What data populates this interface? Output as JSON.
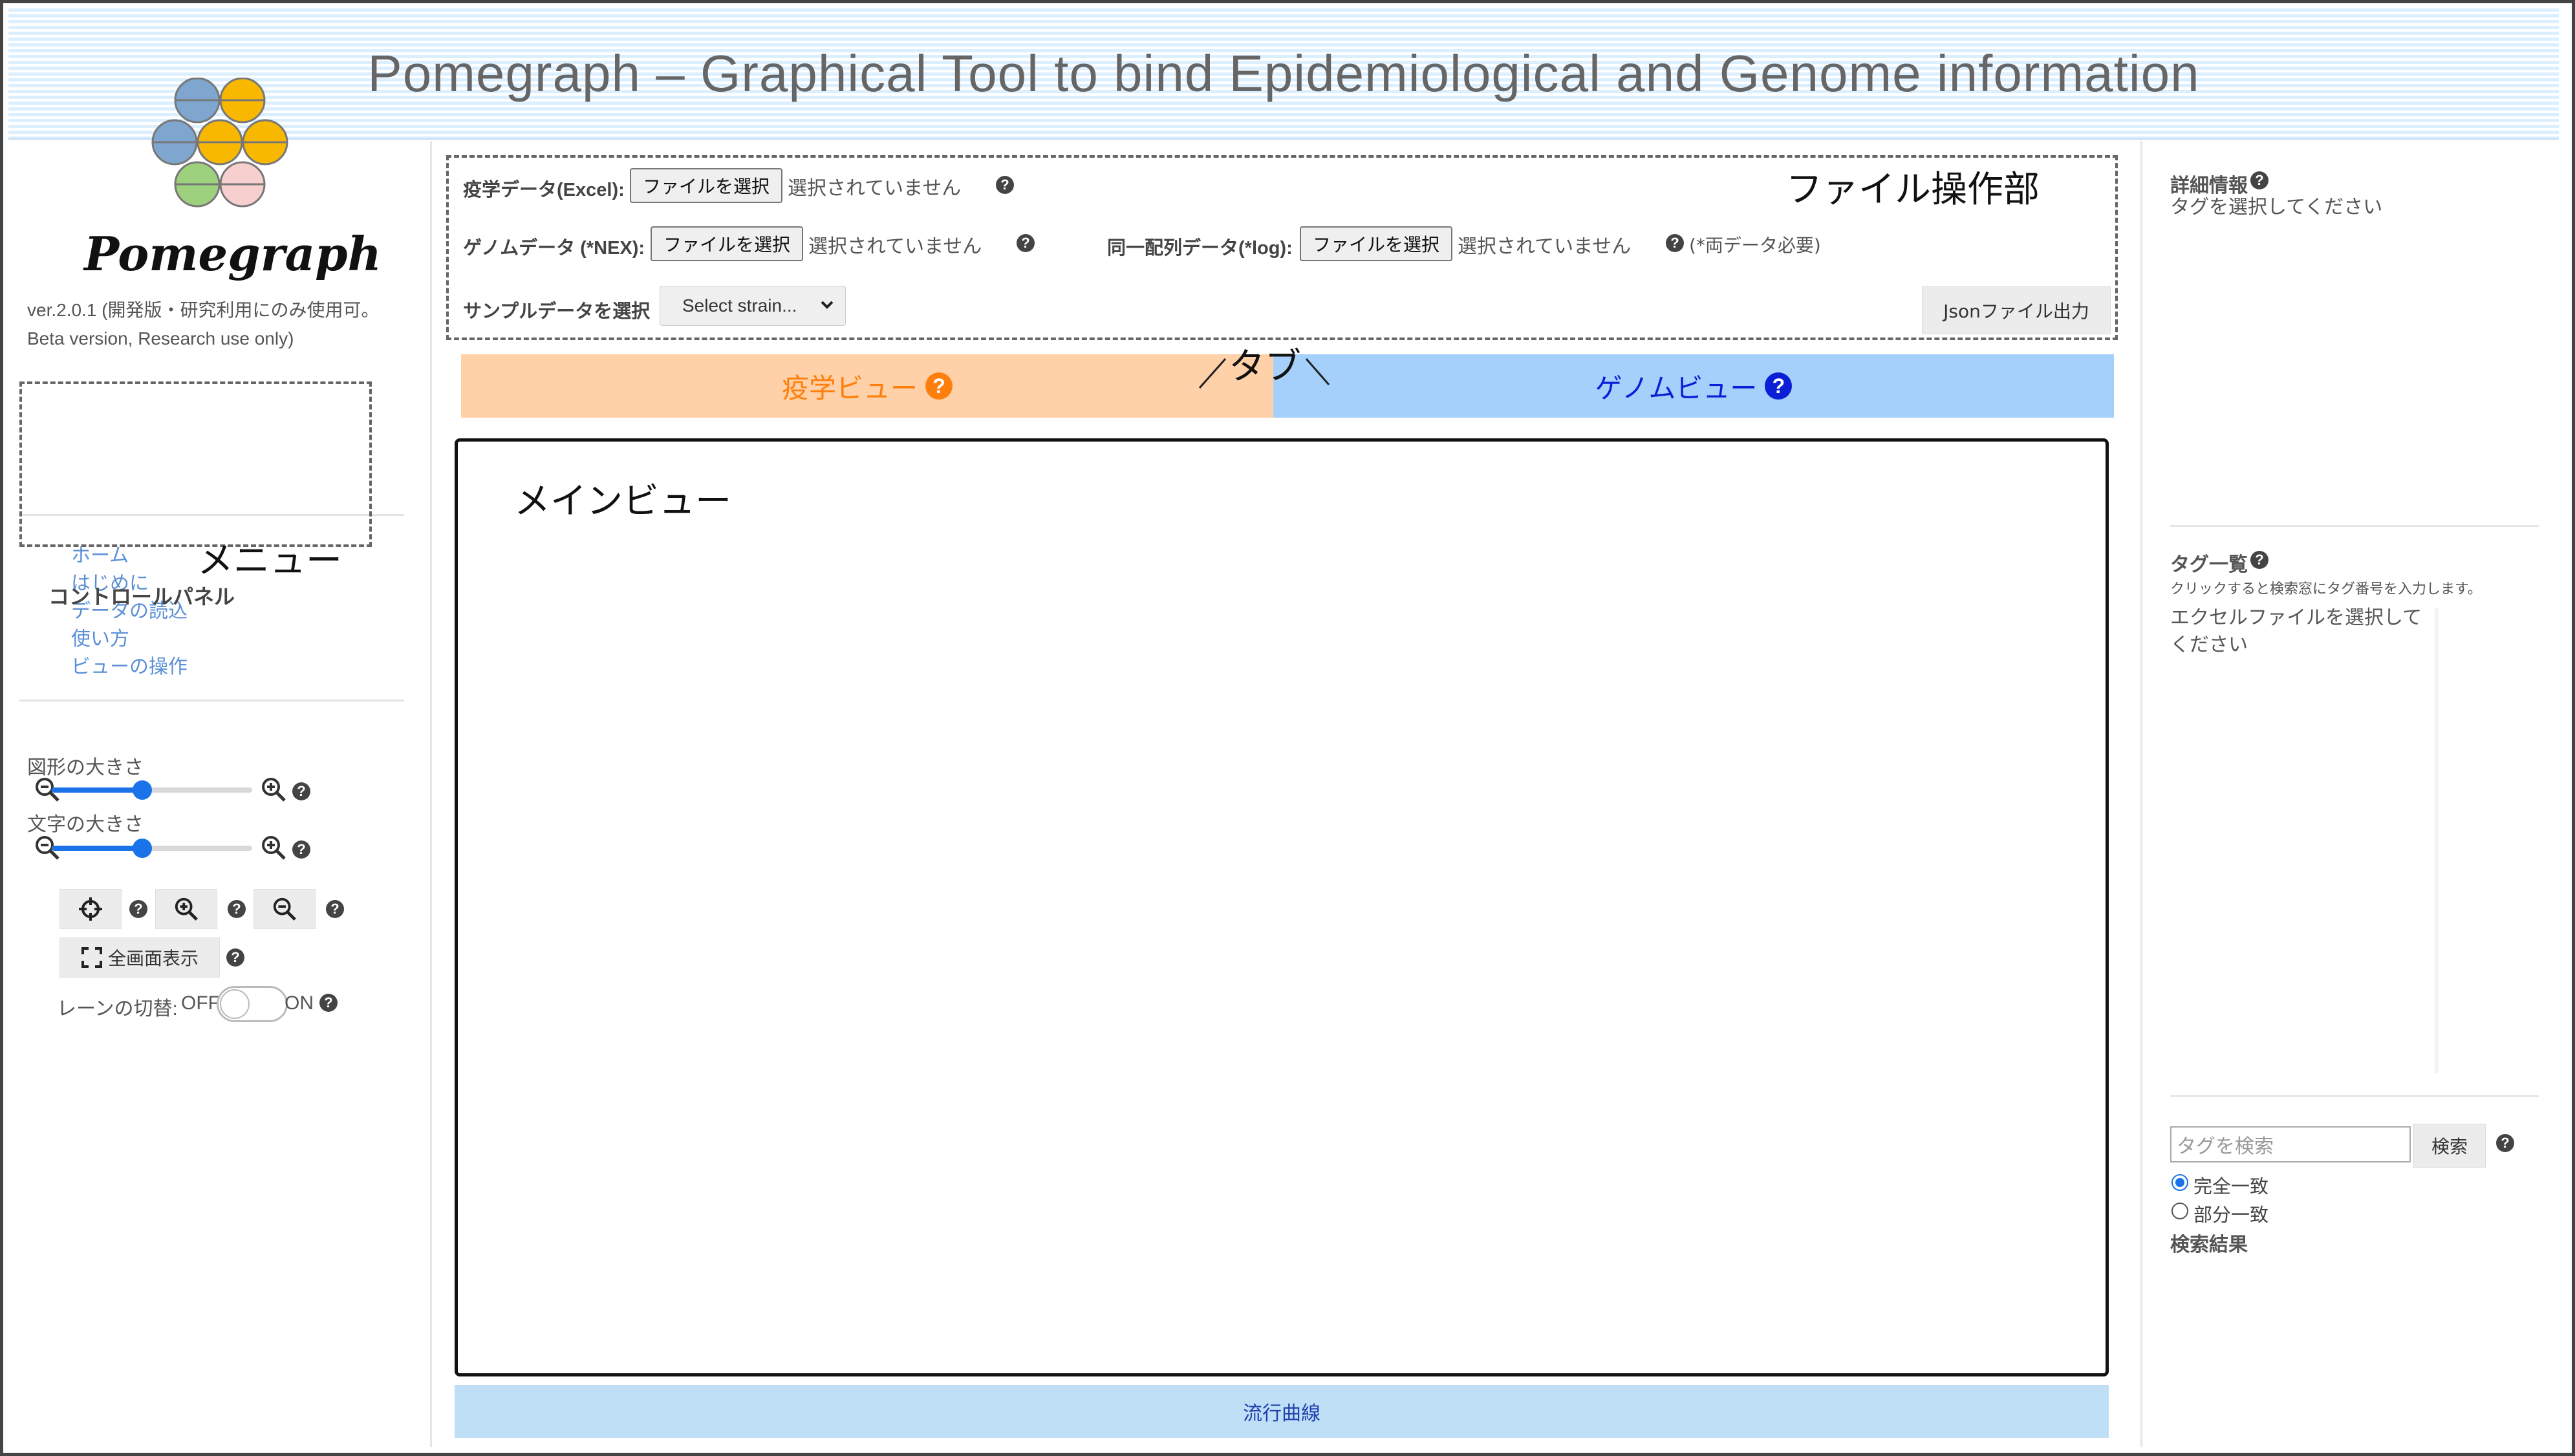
{
  "header": {
    "title": "Pomegraph – Graphical Tool to bind Epidemiological and Genome information"
  },
  "logo": {
    "text": "Pomegraph",
    "colors": [
      "#7ea6cf",
      "#f9b800",
      "#9ed17d",
      "#f8cfcf"
    ]
  },
  "version": {
    "line1": "ver.2.0.1 (開発版・研究利用にのみ使用可。",
    "line2": "Beta version, Research use only)"
  },
  "menu": {
    "annotation": "メニュー",
    "items": [
      "ホーム",
      "はじめに",
      "データの読込",
      "使い方",
      "ビューの操作"
    ]
  },
  "control_panel": {
    "title": "コントロールパネル",
    "shape_size_label": "図形の大きさ",
    "shape_size_level": 0.45,
    "text_size_label": "文字の大きさ",
    "text_size_level": 0.45,
    "fullscreen_label": "全画面表示",
    "lane_toggle_label": "レーンの切替:",
    "lane_off": "OFF",
    "lane_on": "ON",
    "help": "?"
  },
  "file_ops": {
    "annotation": "ファイル操作部",
    "epi_label": "疫学データ(Excel):",
    "genome_label": "ゲノムデータ (*NEX):",
    "seq_label": "同一配列データ(*log):",
    "choose_file": "ファイルを選択",
    "no_file": "選択されていません",
    "both_required": "(*両データ必要)",
    "sample_label": "サンプルデータを選択",
    "sample_select": "Select strain...",
    "json_export": "Jsonファイル出力"
  },
  "tabs": {
    "annotation": "タブ",
    "epi_view": "疫学ビュー",
    "genome_view": "ゲノムビュー",
    "epi_color": "#ff7f0e",
    "genome_color": "#0a1fd6"
  },
  "main_view": {
    "annotation": "メインビュー"
  },
  "epidemic_curve": {
    "label": "流行曲線"
  },
  "right_panel": {
    "detail_title": "詳細情報",
    "detail_text": "タグを選択してください",
    "tag_list_title": "タグ一覧",
    "tag_list_hint": "クリックすると検索窓にタグ番号を入力します。",
    "tag_list_text_1": "エクセルファイルを選択して",
    "tag_list_text_2": "ください",
    "search_placeholder": "タグを検索",
    "search_button": "検索",
    "exact_match": "完全一致",
    "partial_match": "部分一致",
    "results_title": "検索結果"
  }
}
